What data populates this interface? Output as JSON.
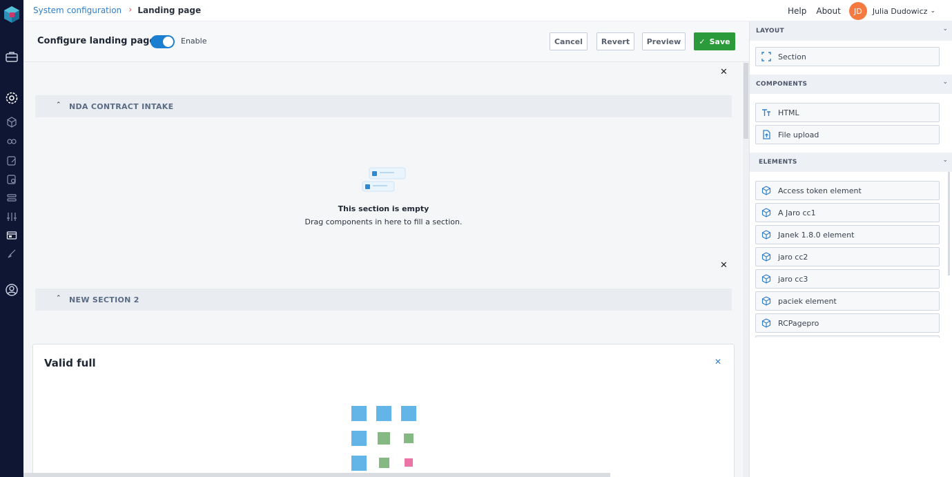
{
  "breadcrumb": {
    "parent": "System configuration",
    "current": "Landing page"
  },
  "header": {
    "help": "Help",
    "about": "About",
    "user_initials": "JD",
    "user_name": "Julia Dudowicz"
  },
  "toolbar": {
    "title": "Configure landing page",
    "enable_label": "Enable",
    "enabled": true,
    "cancel_label": "Cancel",
    "revert_label": "Revert",
    "preview_label": "Preview",
    "save_label": "Save"
  },
  "sections": [
    {
      "label": "NDA CONTRACT INTAKE"
    },
    {
      "label": "NEW SECTION 2"
    }
  ],
  "empty_state": {
    "title": "This section is empty",
    "subtitle": "Drag components in here to fill a section."
  },
  "card": {
    "title": "Valid full"
  },
  "panel": {
    "layout": {
      "label": "LAYOUT",
      "items": [
        {
          "label": "Section",
          "icon": "section-icon"
        }
      ]
    },
    "components": {
      "label": "COMPONENTS",
      "items": [
        {
          "label": "HTML",
          "icon": "text-format-icon"
        },
        {
          "label": "File upload",
          "icon": "file-upload-icon"
        }
      ]
    },
    "elements": {
      "label": "ELEMENTS",
      "items": [
        {
          "label": "Access token element",
          "icon": "cube-icon"
        },
        {
          "label": "A Jaro cc1",
          "icon": "cube-icon"
        },
        {
          "label": "Janek 1.8.0 element",
          "icon": "cube-icon"
        },
        {
          "label": "jaro cc2",
          "icon": "cube-icon"
        },
        {
          "label": "jaro cc3",
          "icon": "cube-icon"
        },
        {
          "label": "paciek element",
          "icon": "cube-icon"
        },
        {
          "label": "RCPagepro",
          "icon": "cube-icon"
        }
      ]
    }
  },
  "colors": {
    "nav_bg": "#0e1633",
    "accent": "#1b7fd1",
    "save_green": "#2a9a3b",
    "avatar": "#f47a42",
    "link": "#2f7fc9",
    "tile_blue": "#64b5e7",
    "tile_green": "#86b883",
    "tile_pink": "#eb76a6"
  }
}
